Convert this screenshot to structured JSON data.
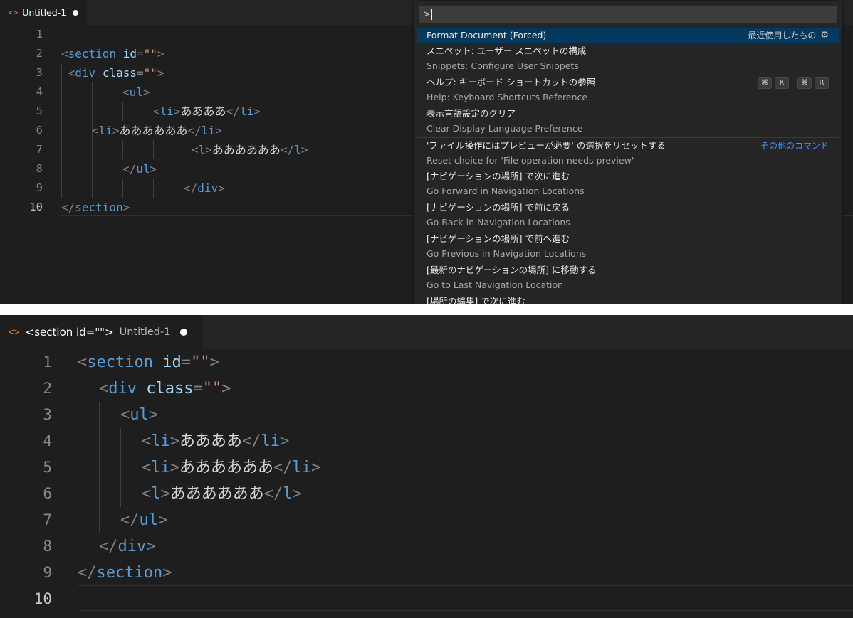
{
  "top": {
    "tab": {
      "icon": "code-file-icon",
      "icon_glyph": "<>",
      "title": "Untitled-1"
    },
    "lines": [
      {
        "num": "1",
        "tokens": []
      },
      {
        "num": "2",
        "tokens": [
          [
            "br",
            "<"
          ],
          [
            "tag",
            "section"
          ],
          [
            "sp",
            " "
          ],
          [
            "attr",
            "id"
          ],
          [
            "br",
            "="
          ],
          [
            "str",
            "\"\""
          ],
          [
            "br",
            ">"
          ]
        ]
      },
      {
        "num": "3",
        "tokens": [
          [
            "sp",
            " "
          ],
          [
            "br",
            "<"
          ],
          [
            "tag",
            "div"
          ],
          [
            "sp",
            " "
          ],
          [
            "attr",
            "class"
          ],
          [
            "br",
            "="
          ],
          [
            "str",
            "\"\""
          ],
          [
            "br",
            ">"
          ]
        ]
      },
      {
        "num": "4",
        "tokens": [
          [
            "br",
            "<"
          ],
          [
            "tag",
            "ul"
          ],
          [
            "br",
            ">"
          ]
        ]
      },
      {
        "num": "5",
        "tokens": [
          [
            "br",
            "<"
          ],
          [
            "tag",
            "li"
          ],
          [
            "br",
            ">"
          ],
          [
            "jp",
            "ああああ"
          ],
          [
            "br",
            "</"
          ],
          [
            "tag",
            "li"
          ],
          [
            "br",
            ">"
          ]
        ]
      },
      {
        "num": "6",
        "tokens": [
          [
            "br",
            "<"
          ],
          [
            "tag",
            "li"
          ],
          [
            "br",
            ">"
          ],
          [
            "jp",
            "ああああああ"
          ],
          [
            "br",
            "</"
          ],
          [
            "tag",
            "li"
          ],
          [
            "br",
            ">"
          ]
        ]
      },
      {
        "num": "7",
        "tokens": [
          [
            "br",
            "<"
          ],
          [
            "tag",
            "l"
          ],
          [
            "br",
            ">"
          ],
          [
            "jp",
            "ああああああ"
          ],
          [
            "br",
            "</"
          ],
          [
            "tag",
            "l"
          ],
          [
            "br",
            ">"
          ]
        ]
      },
      {
        "num": "8",
        "tokens": [
          [
            "br",
            "</"
          ],
          [
            "tag",
            "ul"
          ],
          [
            "br",
            ">"
          ]
        ]
      },
      {
        "num": "9",
        "tokens": [
          [
            "br",
            "</"
          ],
          [
            "tag",
            "div"
          ],
          [
            "br",
            ">"
          ]
        ]
      },
      {
        "num": "10",
        "tokens": [
          [
            "br",
            "</"
          ],
          [
            "tag",
            "section"
          ],
          [
            "br",
            ">"
          ]
        ]
      }
    ],
    "palette": {
      "input_value": ">",
      "items": [
        {
          "label": "Format Document (Forced)",
          "right": "最近使用したもの",
          "right_icon": "gear-icon"
        },
        {
          "label": "スニペット: ユーザー スニペットの構成",
          "detail": "Snippets: Configure User Snippets"
        },
        {
          "label": "ヘルプ: キーボード ショートカットの参照",
          "detail": "Help: Keyboard Shortcuts Reference",
          "keys": [
            "⌘",
            "K",
            "⌘",
            "R"
          ]
        },
        {
          "label": "表示言語設定のクリア",
          "detail": "Clear Display Language Preference"
        },
        {
          "label": "'ファイル操作にはプレビューが必要' の選択をリセットする",
          "detail": "Reset choice for 'File operation needs preview'",
          "right": "その他のコマンド"
        },
        {
          "label": "[ナビゲーションの場所] で次に進む",
          "detail": "Go Forward in Navigation Locations"
        },
        {
          "label": "[ナビゲーションの場所] で前に戻る",
          "detail": "Go Back in Navigation Locations"
        },
        {
          "label": "[ナビゲーションの場所] で前へ進む",
          "detail": "Go Previous in Navigation Locations"
        },
        {
          "label": "[最新のナビゲーションの場所] に移動する",
          "detail": "Go to Last Navigation Location"
        },
        {
          "label": "[場所の編集] で次に進む"
        }
      ]
    }
  },
  "bottom": {
    "tab": {
      "icon": "code-file-icon",
      "icon_glyph": "<>",
      "breadcrumb": "<section id=\"\">",
      "title": "Untitled-1"
    },
    "lines": [
      {
        "num": "1",
        "tokens": [
          [
            "br",
            "<"
          ],
          [
            "tag",
            "section"
          ],
          [
            "sp",
            " "
          ],
          [
            "attr",
            "id"
          ],
          [
            "br",
            "="
          ],
          [
            "str",
            "\"\""
          ],
          [
            "br",
            ">"
          ]
        ]
      },
      {
        "num": "2",
        "tokens": [
          [
            "br",
            "<"
          ],
          [
            "tag",
            "div"
          ],
          [
            "sp",
            " "
          ],
          [
            "attr",
            "class"
          ],
          [
            "br",
            "="
          ],
          [
            "str",
            "\"\""
          ],
          [
            "br",
            ">"
          ]
        ]
      },
      {
        "num": "3",
        "tokens": [
          [
            "br",
            "<"
          ],
          [
            "tag",
            "ul"
          ],
          [
            "br",
            ">"
          ]
        ]
      },
      {
        "num": "4",
        "tokens": [
          [
            "br",
            "<"
          ],
          [
            "tag",
            "li"
          ],
          [
            "br",
            ">"
          ],
          [
            "jp",
            "ああああ"
          ],
          [
            "br",
            "</"
          ],
          [
            "tag",
            "li"
          ],
          [
            "br",
            ">"
          ]
        ]
      },
      {
        "num": "5",
        "tokens": [
          [
            "br",
            "<"
          ],
          [
            "tag",
            "li"
          ],
          [
            "br",
            ">"
          ],
          [
            "jp",
            "ああああああ"
          ],
          [
            "br",
            "</"
          ],
          [
            "tag",
            "li"
          ],
          [
            "br",
            ">"
          ]
        ]
      },
      {
        "num": "6",
        "tokens": [
          [
            "br",
            "<"
          ],
          [
            "tag",
            "l"
          ],
          [
            "br",
            ">"
          ],
          [
            "jp",
            "ああああああ"
          ],
          [
            "br",
            "</"
          ],
          [
            "tag",
            "l"
          ],
          [
            "br",
            ">"
          ]
        ]
      },
      {
        "num": "7",
        "tokens": [
          [
            "br",
            "</"
          ],
          [
            "tag",
            "ul"
          ],
          [
            "br",
            ">"
          ]
        ]
      },
      {
        "num": "8",
        "tokens": [
          [
            "br",
            "</"
          ],
          [
            "tag",
            "div"
          ],
          [
            "br",
            ">"
          ]
        ]
      },
      {
        "num": "9",
        "tokens": [
          [
            "br",
            "</"
          ],
          [
            "tag",
            "section"
          ],
          [
            "br",
            ">"
          ]
        ]
      },
      {
        "num": "10",
        "tokens": []
      }
    ]
  }
}
